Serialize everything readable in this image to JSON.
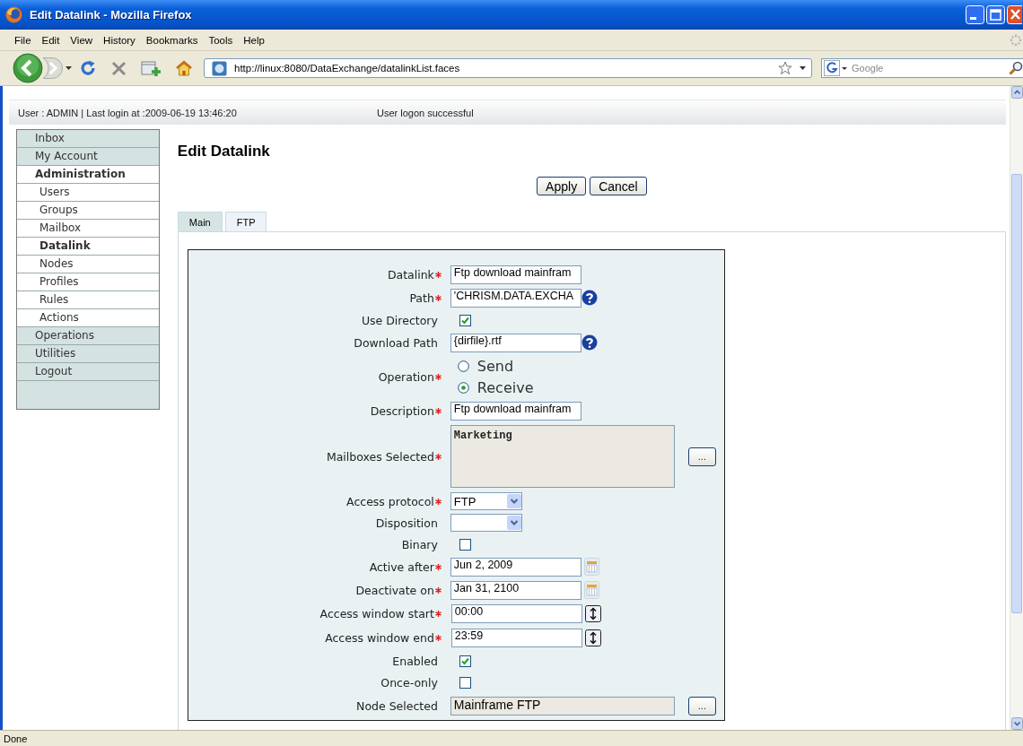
{
  "window": {
    "title": "Edit Datalink - Mozilla Firefox"
  },
  "menu": [
    "File",
    "Edit",
    "View",
    "History",
    "Bookmarks",
    "Tools",
    "Help"
  ],
  "address_bar": {
    "url": "http://linux:8080/DataExchange/datalinkList.faces"
  },
  "search": {
    "placeholder": "Google"
  },
  "header": {
    "user_info": "User : ADMIN | Last login at :2009-06-19 13:46:20",
    "message": "User logon successful"
  },
  "sidebar": {
    "items": [
      {
        "label": "Inbox",
        "expanded": false
      },
      {
        "label": "My Account",
        "expanded": false
      },
      {
        "label": "Administration",
        "expanded": true,
        "children": [
          {
            "label": "Users",
            "selected": false
          },
          {
            "label": "Groups",
            "selected": false
          },
          {
            "label": "Mailbox",
            "selected": false
          },
          {
            "label": "Datalink",
            "selected": true
          },
          {
            "label": "Nodes",
            "selected": false
          },
          {
            "label": "Profiles",
            "selected": false
          },
          {
            "label": "Rules",
            "selected": false
          },
          {
            "label": "Actions",
            "selected": false
          }
        ]
      },
      {
        "label": "Operations",
        "expanded": false
      },
      {
        "label": "Utilities",
        "expanded": false
      },
      {
        "label": "Logout",
        "expanded": false
      }
    ]
  },
  "page_title": "Edit Datalink",
  "buttons": [
    "Apply",
    "Cancel"
  ],
  "tabs": [
    {
      "label": "Main",
      "selected": true
    },
    {
      "label": "FTP",
      "selected": false
    }
  ],
  "form": {
    "fields": [
      {
        "kind": "text",
        "label": "Datalink",
        "required": true,
        "value": "Ftp download mainfram",
        "help": false
      },
      {
        "kind": "text",
        "label": "Path",
        "required": true,
        "value": "'CHRISM.DATA.EXCHA",
        "help": true
      },
      {
        "kind": "checkbox",
        "label": "Use Directory",
        "required": false,
        "checked": true
      },
      {
        "kind": "text",
        "label": "Download Path",
        "required": false,
        "value": "{dirfile}.rtf",
        "help": true
      },
      {
        "kind": "radio",
        "label": "Operation",
        "required": true,
        "options": [
          {
            "label": "Send",
            "selected": false
          },
          {
            "label": "Receive",
            "selected": true
          }
        ]
      },
      {
        "kind": "text",
        "label": "Description",
        "required": true,
        "value": "Ftp download mainfram",
        "help": false
      },
      {
        "kind": "list",
        "label": "Mailboxes Selected",
        "required": true,
        "value": "Marketing",
        "button": "..."
      },
      {
        "kind": "select",
        "label": "Access protocol",
        "required": true,
        "value": "FTP"
      },
      {
        "kind": "select",
        "label": "Disposition",
        "required": false
      },
      {
        "kind": "checkbox",
        "label": "Binary",
        "required": false,
        "checked": false
      },
      {
        "kind": "date",
        "label": "Active after",
        "required": true,
        "value": "Jun 2, 2009"
      },
      {
        "kind": "date",
        "label": "Deactivate on",
        "required": true,
        "value": "Jan 31, 2100"
      },
      {
        "kind": "time",
        "label": "Access window start",
        "required": true,
        "value": "00:00"
      },
      {
        "kind": "time",
        "label": "Access window end",
        "required": true,
        "value": "23:59"
      },
      {
        "kind": "checkbox",
        "label": "Enabled",
        "required": false,
        "checked": true
      },
      {
        "kind": "checkbox",
        "label": "Once-only",
        "required": false,
        "checked": false
      },
      {
        "kind": "picker",
        "label": "Node Selected",
        "required": false,
        "value": "Mainframe FTP",
        "button": "..."
      }
    ]
  },
  "status_bar": "Done"
}
